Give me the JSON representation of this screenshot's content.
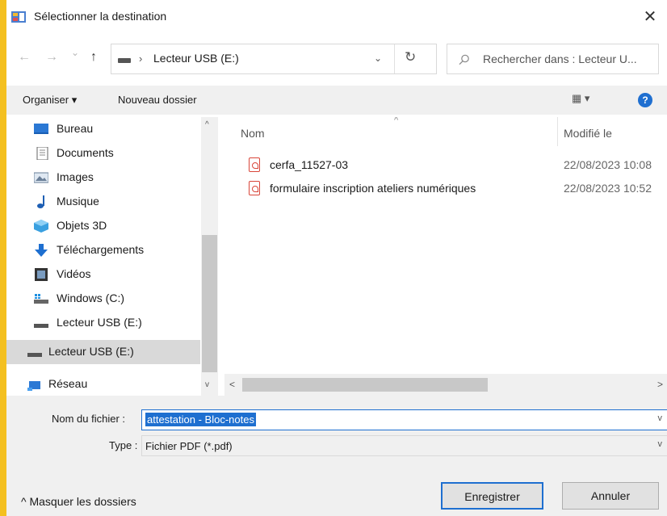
{
  "window": {
    "title": "Sélectionner la destination",
    "close_glyph": "✕"
  },
  "nav": {
    "back_glyph": "←",
    "forward_glyph": "→",
    "recent_glyph": "⌄",
    "up_glyph": "↑",
    "path_sep": "›",
    "path": "Lecteur USB (E:)",
    "dropdown_glyph": "⌄",
    "refresh_glyph": "↻",
    "search_placeholder": "Rechercher dans : Lecteur U..."
  },
  "toolbar": {
    "organize": "Organiser ▾",
    "new_folder": "Nouveau dossier",
    "view_glyph": "▦ ▾",
    "help_glyph": "?"
  },
  "sidebar": {
    "items": [
      {
        "label": "Bureau",
        "icon": "desktop-icon"
      },
      {
        "label": "Documents",
        "icon": "documents-icon"
      },
      {
        "label": "Images",
        "icon": "images-icon"
      },
      {
        "label": "Musique",
        "icon": "music-icon"
      },
      {
        "label": "Objets 3D",
        "icon": "3d-objects-icon"
      },
      {
        "label": "Téléchargements",
        "icon": "downloads-icon"
      },
      {
        "label": "Vidéos",
        "icon": "videos-icon"
      },
      {
        "label": "Windows (C:)",
        "icon": "drive-c-icon"
      },
      {
        "label": "Lecteur USB (E:)",
        "icon": "usb-drive-icon"
      },
      {
        "label": "Lecteur USB (E:)",
        "icon": "usb-drive-icon",
        "selected": true
      },
      {
        "label": "Réseau",
        "icon": "network-icon"
      }
    ]
  },
  "filelist": {
    "columns": {
      "name": "Nom",
      "modified": "Modifié le"
    },
    "files": [
      {
        "name": "cerfa_11527-03",
        "modified": "22/08/2023 10:08"
      },
      {
        "name": "formulaire inscription ateliers numériques",
        "modified": "22/08/2023 10:52"
      }
    ]
  },
  "form": {
    "filename_label": "Nom du fichier :",
    "filename_value": "attestation - Bloc-notes",
    "type_label": "Type :",
    "type_value": "Fichier PDF (*.pdf)"
  },
  "footer": {
    "toggle_folders": "^  Masquer les dossiers",
    "save": "Enregistrer",
    "cancel": "Annuler"
  },
  "colors": {
    "accent": "#1e6fd0",
    "pdf_red": "#d9463a",
    "frame": "#f4c020"
  }
}
